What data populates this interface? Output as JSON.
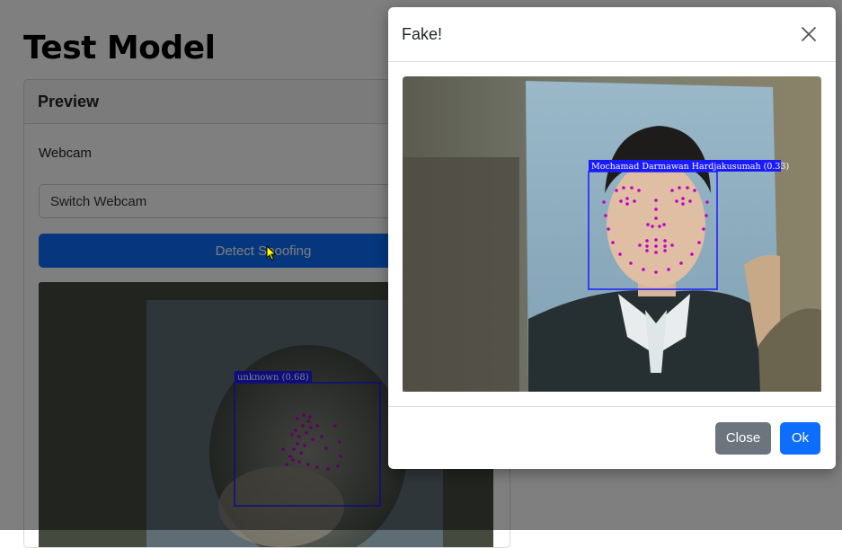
{
  "page": {
    "title": "Test Model"
  },
  "card": {
    "header": "Preview",
    "webcam_label": "Webcam",
    "select_value": "Switch Webcam",
    "detect_button": "Detect Spoofing",
    "live_detection_label": "unknown (0.68)"
  },
  "modal": {
    "title": "Fake!",
    "detection_label": "Mochamad Darmawan Hardjakusumah (0.33)",
    "close_button": "Close",
    "ok_button": "Ok"
  },
  "colors": {
    "primary": "#0d6efd",
    "secondary": "#6c757d",
    "box_outline": "#1a1aff",
    "landmark": "#c000c0"
  },
  "icons": {
    "modal_close": "close-icon",
    "cursor": "pointer-cursor-icon"
  }
}
